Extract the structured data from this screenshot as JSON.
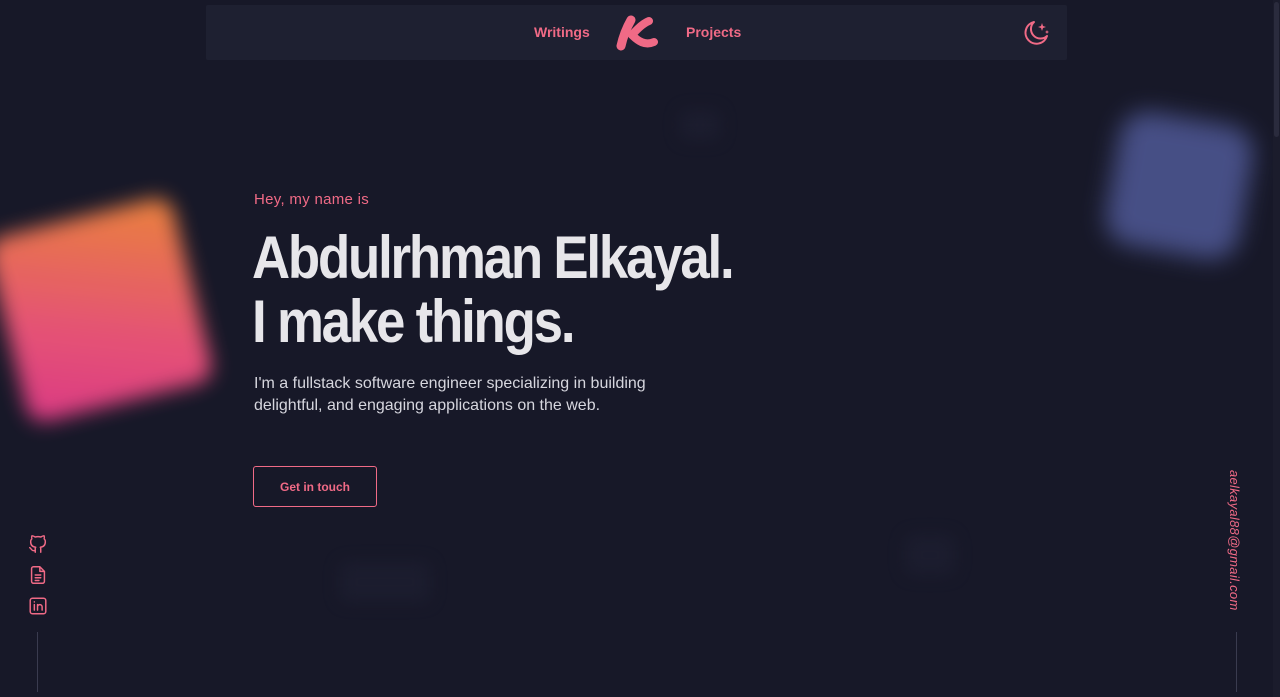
{
  "nav": {
    "writings_label": "Writings",
    "projects_label": "Projects",
    "logo_icon": "k-logo-icon",
    "theme_icon": "moon-stars-icon"
  },
  "hero": {
    "greeting": "Hey, my name is",
    "name_line": "Abdulrhman Elkayal.",
    "tagline_line": "I make things.",
    "description": "I'm a fullstack software engineer specializing in building delightful, and engaging applications on the web.",
    "cta_label": "Get in touch"
  },
  "social": {
    "icons": [
      "github-icon",
      "resume-document-icon",
      "linkedin-icon"
    ]
  },
  "email": "aelkayal88@gmail.com",
  "colors": {
    "background": "#171828",
    "navbar": "#1e2031",
    "accent": "#f06a86",
    "headline": "#e7e6ea",
    "blob_orange": "#f6893c",
    "blob_pink": "#e53b8a",
    "blob_blue": "#4c5590"
  }
}
